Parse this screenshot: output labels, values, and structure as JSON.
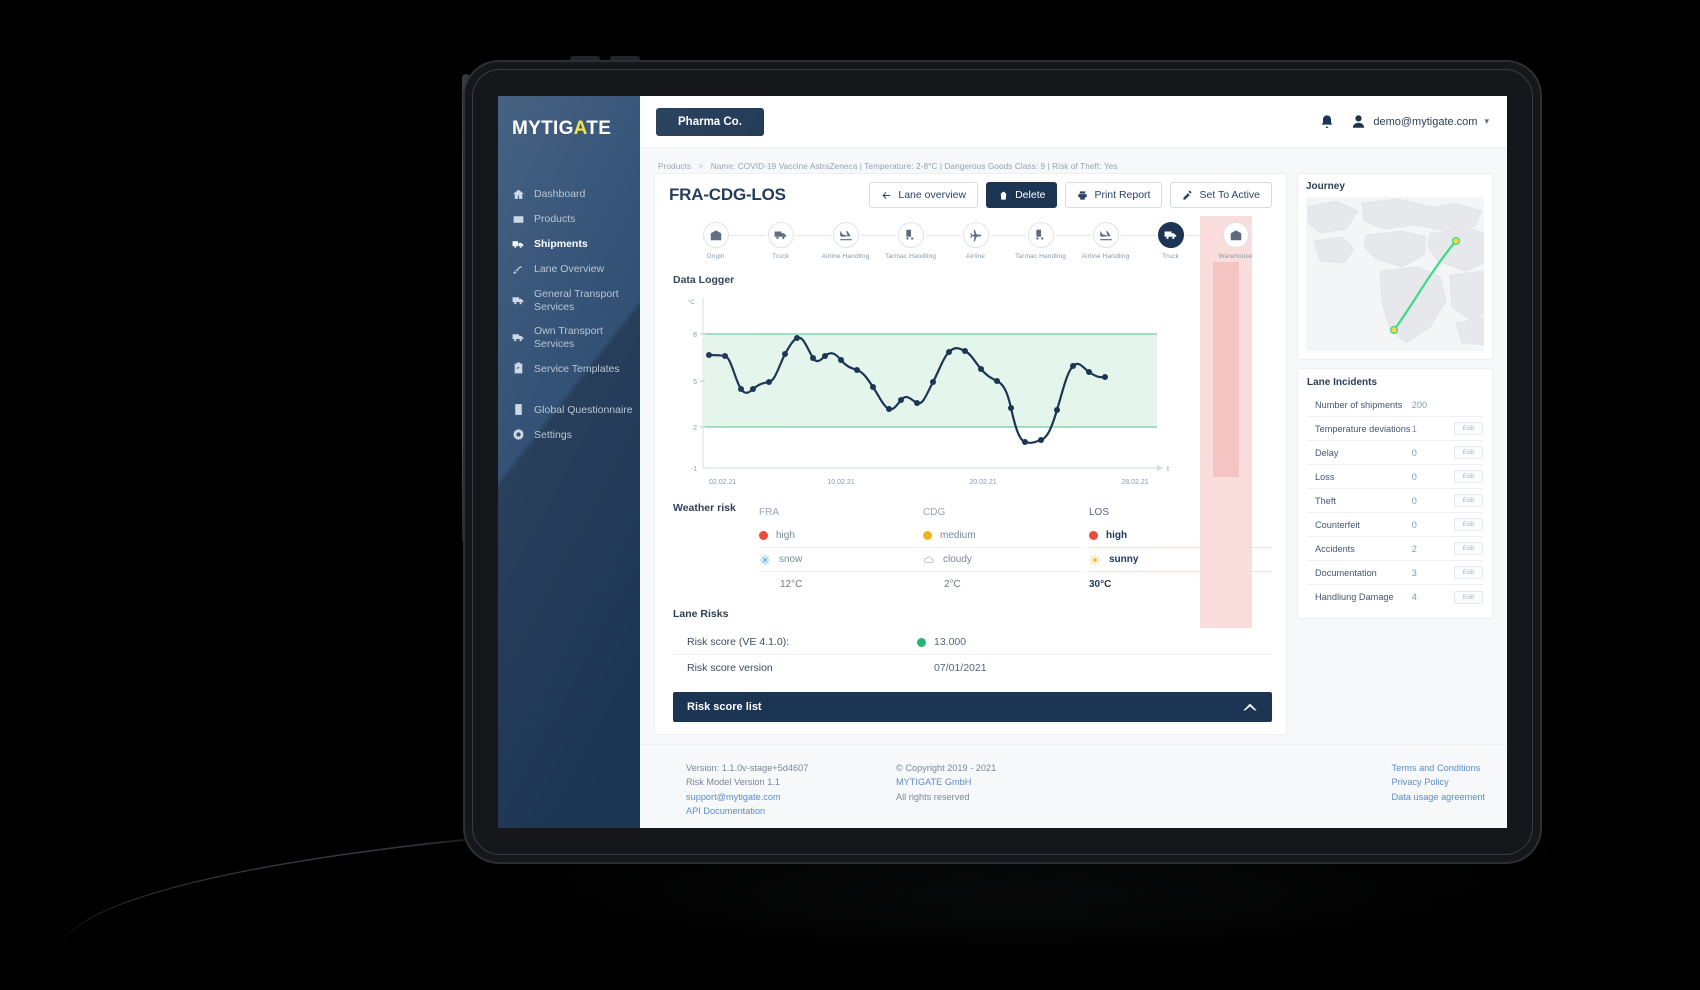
{
  "brand": {
    "name_part1": "MYTIG",
    "name_accent": "A",
    "name_part2": "TE"
  },
  "sidebar": {
    "items": [
      {
        "label": "Dashboard",
        "icon": "home-icon",
        "active": false
      },
      {
        "label": "Products",
        "icon": "box-icon",
        "active": false
      },
      {
        "label": "Shipments",
        "icon": "shipment-truck-icon",
        "active": true
      },
      {
        "label": "Lane Overview",
        "icon": "lane-icon",
        "active": false
      },
      {
        "label": "General Transport Services",
        "icon": "truck-icon",
        "active": false
      },
      {
        "label": "Own Transport Services",
        "icon": "truck-icon",
        "active": false
      },
      {
        "label": "Service Templates",
        "icon": "clipboard-icon",
        "active": false
      },
      {
        "label": "Global Questionnaire",
        "icon": "list-icon",
        "active": false
      },
      {
        "label": "Settings",
        "icon": "gear-icon",
        "active": false
      }
    ]
  },
  "topbar": {
    "tenant": "Pharma Co.",
    "user_email": "demo@mytigate.com",
    "caret": "▾"
  },
  "breadcrumb": {
    "root": "Products",
    "separator": ">",
    "detail": "Name: COVID-19 Vaccine AstraZeneca  |  Temperature: 2-8°C  |  Dangerous Goods Class: 9  |  Risk of Theft: Yes"
  },
  "page": {
    "title": "FRA-CDG-LOS",
    "actions": {
      "lane_overview": "Lane overview",
      "delete": "Delete",
      "print_report": "Print Report",
      "set_to_active": "Set To Active"
    }
  },
  "stepper": {
    "steps": [
      {
        "label": "Origin",
        "icon": "warehouse-icon",
        "active": false
      },
      {
        "label": "Truck",
        "icon": "truck-icon",
        "active": false
      },
      {
        "label": "Airline Handling",
        "icon": "plane-landing-icon",
        "active": false
      },
      {
        "label": "Tarmac Handling",
        "icon": "forklift-icon",
        "active": false
      },
      {
        "label": "Airline",
        "icon": "plane-icon",
        "active": false
      },
      {
        "label": "Tarmac Handling",
        "icon": "forklift-icon",
        "active": false
      },
      {
        "label": "Airline Handling",
        "icon": "plane-landing-icon",
        "active": false
      },
      {
        "label": "Truck",
        "icon": "truck-icon",
        "active": true
      },
      {
        "label": "Warehouse",
        "icon": "warehouse-icon",
        "active": false
      }
    ]
  },
  "data_logger": {
    "title": "Data Logger"
  },
  "chart_data": {
    "type": "line",
    "title": "Data Logger",
    "xlabel": "t",
    "ylabel": "°C",
    "ylim": [
      -1,
      9.5
    ],
    "yticks": [
      8,
      5,
      2,
      -1
    ],
    "xticks": [
      "02.02.21",
      "10.02.21",
      "20.02.21",
      "28.02.21"
    ],
    "grid": false,
    "threshold_band": {
      "min": 2,
      "max": 8,
      "color": "#3cba8a",
      "fill": "#e4f5ec"
    },
    "series": [
      {
        "name": "Temperature",
        "color": "#1c3553",
        "values": [
          6.6,
          6.6,
          6.5,
          5.0,
          4.3,
          4.8,
          4.9,
          5.9,
          6.7,
          7.6,
          7.8,
          7.0,
          6.1,
          6.5,
          6.3,
          5.4,
          4.8,
          4.6,
          4.2,
          3.1,
          3.4,
          4.2,
          3.9,
          4.6,
          5.6,
          6.9,
          7.2,
          7.1,
          6.8,
          6.2,
          5.9,
          5.6,
          2.2,
          1.2,
          1.1,
          2.1,
          5.2,
          6.0,
          5.6
        ]
      }
    ]
  },
  "weather_risk": {
    "title": "Weather risk",
    "columns": [
      {
        "airport": "FRA",
        "risk": "high",
        "risk_color": "#e74c3c",
        "condition": "snow",
        "condition_icon": "snowflake-icon",
        "temperature": "12°C",
        "highlight": false
      },
      {
        "airport": "CDG",
        "risk": "medium",
        "risk_color": "#f1b31c",
        "condition": "cloudy",
        "condition_icon": "cloud-icon",
        "temperature": "2°C",
        "highlight": false
      },
      {
        "airport": "LOS",
        "risk": "high",
        "risk_color": "#e74c3c",
        "condition": "sunny",
        "condition_icon": "sun-icon",
        "temperature": "30°C",
        "highlight": true
      }
    ]
  },
  "lane_risks": {
    "title": "Lane Risks",
    "rows": [
      {
        "label": "Risk score (VE 4.1.0):",
        "value": "13.000",
        "dot_color": "#22b573"
      },
      {
        "label": "Risk score version",
        "value": "07/01/2021",
        "dot_color": ""
      }
    ]
  },
  "risk_score_list": {
    "label": "Risk score list",
    "chevron": "chevron-up-icon"
  },
  "journey": {
    "title": "Journey"
  },
  "lane_incidents": {
    "title": "Lane Incidents",
    "edit_label": "Edit",
    "rows": [
      {
        "name": "Number of shipments",
        "value": "200",
        "editable": false
      },
      {
        "name": "Temperature deviations",
        "value": "1",
        "editable": true
      },
      {
        "name": "Delay",
        "value": "0",
        "editable": true
      },
      {
        "name": "Loss",
        "value": "0",
        "editable": true
      },
      {
        "name": "Theft",
        "value": "0",
        "editable": true
      },
      {
        "name": "Counterfeit",
        "value": "0",
        "editable": true
      },
      {
        "name": "Accidents",
        "value": "2",
        "editable": true
      },
      {
        "name": "Documentation",
        "value": "3",
        "editable": true
      },
      {
        "name": "Handliung Damage",
        "value": "4",
        "editable": true
      }
    ]
  },
  "footer": {
    "col1_line1": "Version: 1.1.0v-stage+5d4607",
    "col1_line2": "Risk Model Version 1.1",
    "col1_link1": "support@mytigate.com",
    "col1_link2": "API Documentation",
    "col2_line1": "© Copyright 2019 - 2021",
    "col2_link1": "MYTIGATE GmbH",
    "col2_line2": "All rights reserved",
    "col3_link1": "Terms and Conditions",
    "col3_link2": "Privacy Policy",
    "col3_link3": "Data usage agreement"
  }
}
